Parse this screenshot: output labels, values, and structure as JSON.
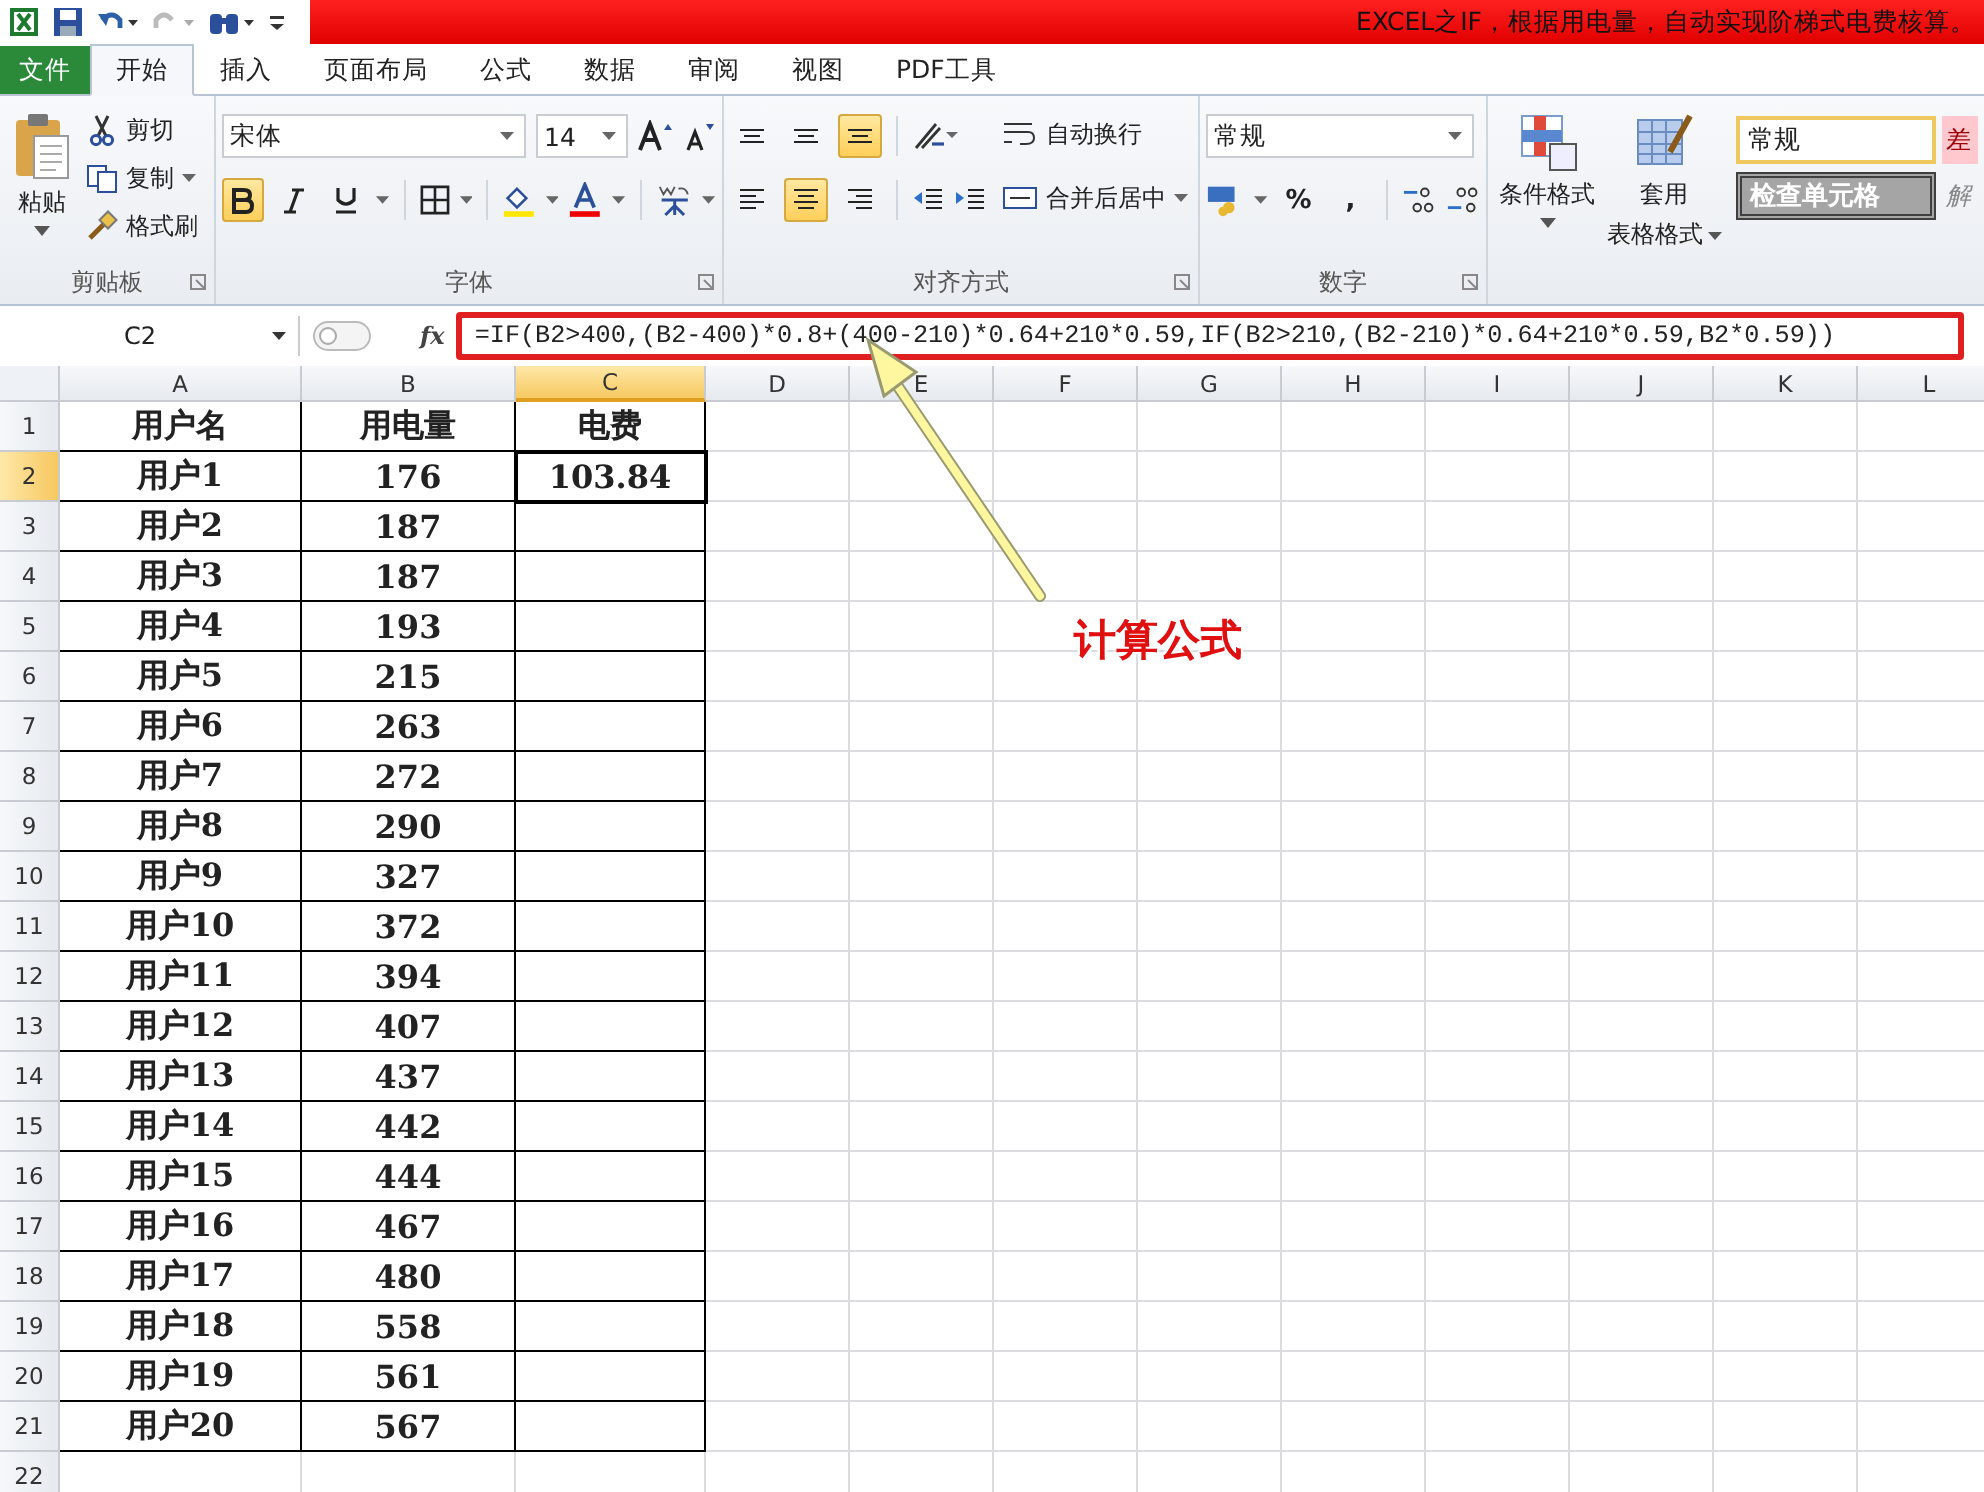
{
  "window": {
    "title": "EXCEL之IF，根据用电量，自动实现阶梯式电费核算。"
  },
  "tabs": [
    {
      "label": "文件",
      "kind": "file",
      "selected": false
    },
    {
      "label": "开始",
      "kind": "tab",
      "selected": true
    },
    {
      "label": "插入",
      "kind": "tab",
      "selected": false
    },
    {
      "label": "页面布局",
      "kind": "tab",
      "selected": false
    },
    {
      "label": "公式",
      "kind": "tab",
      "selected": false
    },
    {
      "label": "数据",
      "kind": "tab",
      "selected": false
    },
    {
      "label": "审阅",
      "kind": "tab",
      "selected": false
    },
    {
      "label": "视图",
      "kind": "tab",
      "selected": false
    },
    {
      "label": "PDF工具",
      "kind": "tab",
      "selected": false
    }
  ],
  "ribbon": {
    "clipboard": {
      "paste": "粘贴",
      "cut": "剪切",
      "copy": "复制",
      "format_painter": "格式刷",
      "label": "剪贴板"
    },
    "font": {
      "font_name": "宋体",
      "font_size": "14",
      "bold_on": true,
      "italic_on": false,
      "underline_on": false,
      "label": "字体"
    },
    "alignment": {
      "top_on": false,
      "middle_on": false,
      "bottom_on": true,
      "left_on": false,
      "center_on": true,
      "right_on": false,
      "wrap_text": "自动换行",
      "merge_center": "合并后居中",
      "label": "对齐方式"
    },
    "number": {
      "format": "常规",
      "percent": "%",
      "comma": ",",
      "label": "数字"
    },
    "styles": {
      "conditional": "条件格式",
      "table_format_line1": "套用",
      "table_format_line2": "表格格式",
      "cell_styles": [
        "常规",
        "差",
        "检查单元格",
        "解"
      ]
    }
  },
  "formula_bar": {
    "name_box": "C2",
    "fx": "fx",
    "formula": "=IF(B2>400,(B2-400)*0.8+(400-210)*0.64+210*0.59,IF(B2>210,(B2-210)*0.64+210*0.59,B2*0.59))",
    "highlighted": true
  },
  "columns": [
    {
      "label": "A",
      "selected": false
    },
    {
      "label": "B",
      "selected": false
    },
    {
      "label": "C",
      "selected": true
    },
    {
      "label": "D",
      "selected": false
    },
    {
      "label": "E",
      "selected": false
    },
    {
      "label": "F",
      "selected": false
    },
    {
      "label": "G",
      "selected": false
    },
    {
      "label": "H",
      "selected": false
    },
    {
      "label": "I",
      "selected": false
    },
    {
      "label": "J",
      "selected": false
    },
    {
      "label": "K",
      "selected": false
    },
    {
      "label": "L",
      "selected": false
    }
  ],
  "rows": [
    {
      "num": "1",
      "selected": false,
      "bordered": true,
      "cells": [
        "用户名",
        "用电量",
        "电费"
      ]
    },
    {
      "num": "2",
      "selected": true,
      "bordered": true,
      "cells": [
        "用户1",
        "176",
        "103.84"
      ]
    },
    {
      "num": "3",
      "selected": false,
      "bordered": true,
      "cells": [
        "用户2",
        "187"
      ]
    },
    {
      "num": "4",
      "selected": false,
      "bordered": true,
      "cells": [
        "用户3",
        "187"
      ]
    },
    {
      "num": "5",
      "selected": false,
      "bordered": true,
      "cells": [
        "用户4",
        "193"
      ]
    },
    {
      "num": "6",
      "selected": false,
      "bordered": true,
      "cells": [
        "用户5",
        "215"
      ]
    },
    {
      "num": "7",
      "selected": false,
      "bordered": true,
      "cells": [
        "用户6",
        "263"
      ]
    },
    {
      "num": "8",
      "selected": false,
      "bordered": true,
      "cells": [
        "用户7",
        "272"
      ]
    },
    {
      "num": "9",
      "selected": false,
      "bordered": true,
      "cells": [
        "用户8",
        "290"
      ]
    },
    {
      "num": "10",
      "selected": false,
      "bordered": true,
      "cells": [
        "用户9",
        "327"
      ]
    },
    {
      "num": "11",
      "selected": false,
      "bordered": true,
      "cells": [
        "用户10",
        "372"
      ]
    },
    {
      "num": "12",
      "selected": false,
      "bordered": true,
      "cells": [
        "用户11",
        "394"
      ]
    },
    {
      "num": "13",
      "selected": false,
      "bordered": true,
      "cells": [
        "用户12",
        "407"
      ]
    },
    {
      "num": "14",
      "selected": false,
      "bordered": true,
      "cells": [
        "用户13",
        "437"
      ]
    },
    {
      "num": "15",
      "selected": false,
      "bordered": true,
      "cells": [
        "用户14",
        "442"
      ]
    },
    {
      "num": "16",
      "selected": false,
      "bordered": true,
      "cells": [
        "用户15",
        "444"
      ]
    },
    {
      "num": "17",
      "selected": false,
      "bordered": true,
      "cells": [
        "用户16",
        "467"
      ]
    },
    {
      "num": "18",
      "selected": false,
      "bordered": true,
      "cells": [
        "用户17",
        "480"
      ]
    },
    {
      "num": "19",
      "selected": false,
      "bordered": true,
      "cells": [
        "用户18",
        "558"
      ]
    },
    {
      "num": "20",
      "selected": false,
      "bordered": true,
      "cells": [
        "用户19",
        "561"
      ]
    },
    {
      "num": "21",
      "selected": false,
      "bordered": true,
      "cells": [
        "用户20",
        "567"
      ]
    },
    {
      "num": "22",
      "selected": false,
      "bordered": false,
      "cells": []
    }
  ],
  "annotation": {
    "label": "计算公式"
  }
}
